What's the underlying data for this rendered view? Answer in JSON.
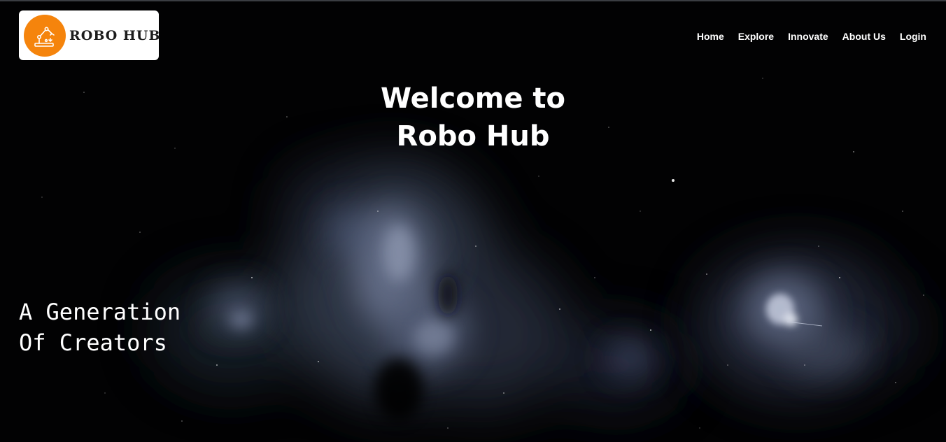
{
  "logo": {
    "text": "ROBO HUB",
    "icon": "robot-arm-icon",
    "badge_color": "#f5840c"
  },
  "nav": {
    "items": [
      {
        "label": "Home"
      },
      {
        "label": "Explore"
      },
      {
        "label": "Innovate"
      },
      {
        "label": "About Us"
      },
      {
        "label": "Login"
      }
    ]
  },
  "hero": {
    "title_line1": "Welcome to",
    "title_line2": "Robo Hub"
  },
  "tagline": {
    "line1": "A Generation",
    "line2": "Of Creators"
  },
  "colors": {
    "background": "#020203",
    "text": "#ffffff",
    "accent": "#f5840c"
  }
}
